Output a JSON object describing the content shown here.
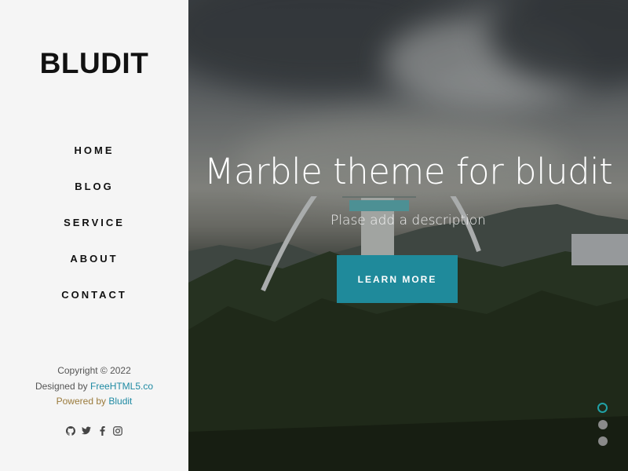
{
  "sidebar": {
    "brand": "BLUDIT",
    "nav": [
      {
        "label": "HOME"
      },
      {
        "label": "BLOG"
      },
      {
        "label": "SERVICE"
      },
      {
        "label": "ABOUT"
      },
      {
        "label": "CONTACT"
      }
    ],
    "footer": {
      "copyright": "Copyright © 2022",
      "designed_prefix": "Designed by",
      "designed_link": "FreeHTML5.co",
      "powered_prefix": "Powered by",
      "powered_link": "Bludit"
    },
    "social_icons": [
      "github-icon",
      "twitter-icon",
      "facebook-icon",
      "instagram-icon"
    ]
  },
  "hero": {
    "title": "Marble theme for bludit",
    "description": "Plase add a description",
    "button": "LEARN MORE",
    "slides_total": 3,
    "slide_active": 1
  },
  "colors": {
    "accent": "#1f8a9b",
    "link": "#1f8aa3",
    "sidebar_bg": "#f5f5f5"
  }
}
